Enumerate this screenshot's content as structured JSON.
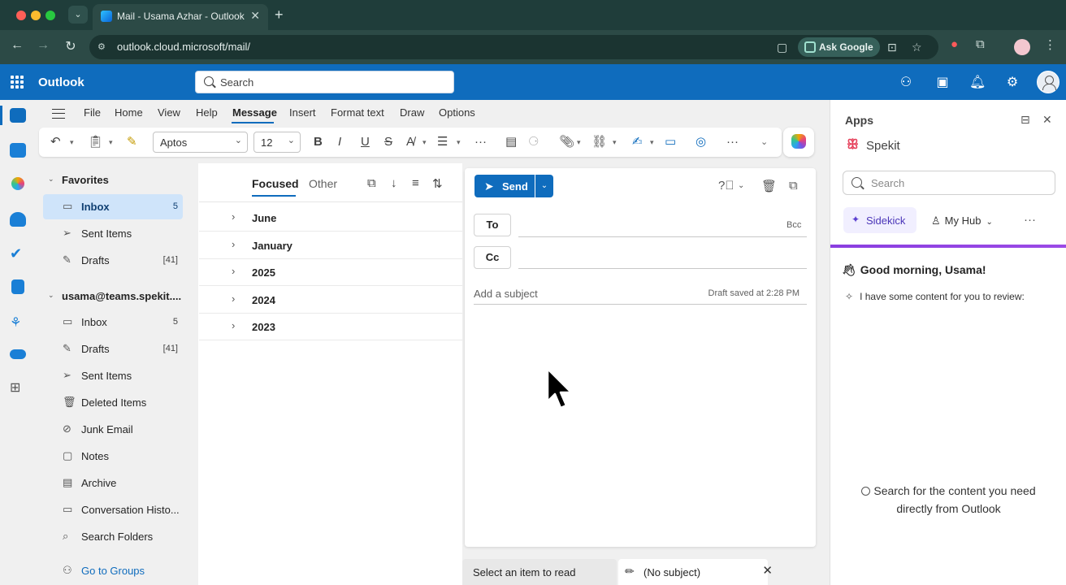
{
  "browser": {
    "tab_title": "Mail - Usama Azhar - Outlook",
    "url": "outlook.cloud.microsoft/mail/",
    "ask_google": "Ask Google"
  },
  "header": {
    "brand": "Outlook",
    "search_placeholder": "Search"
  },
  "ribbon": {
    "tabs": [
      "File",
      "Home",
      "View",
      "Help",
      "Message",
      "Insert",
      "Format text",
      "Draw",
      "Options"
    ],
    "active_tab": "Message",
    "font_name": "Aptos",
    "font_size": "12"
  },
  "folders": {
    "favorites_label": "Favorites",
    "favorites": [
      {
        "label": "Inbox",
        "count": "5",
        "icon": "inbox-icon",
        "selected": true
      },
      {
        "label": "Sent Items",
        "count": "",
        "icon": "send-icon"
      },
      {
        "label": "Drafts",
        "count": "[41]",
        "icon": "pencil-icon"
      }
    ],
    "account_label": "usama@teams.spekit....",
    "account_items": [
      {
        "label": "Inbox",
        "count": "5",
        "icon": "inbox-icon"
      },
      {
        "label": "Drafts",
        "count": "[41]",
        "icon": "pencil-icon"
      },
      {
        "label": "Sent Items",
        "count": "",
        "icon": "send-icon"
      },
      {
        "label": "Deleted Items",
        "count": "",
        "icon": "trash-icon"
      },
      {
        "label": "Junk Email",
        "count": "",
        "icon": "junk-icon"
      },
      {
        "label": "Notes",
        "count": "",
        "icon": "note-icon"
      },
      {
        "label": "Archive",
        "count": "",
        "icon": "archive-icon"
      },
      {
        "label": "Conversation Histo...",
        "count": "",
        "icon": "folder-icon"
      },
      {
        "label": "Search Folders",
        "count": "",
        "icon": "search-folder-icon"
      }
    ],
    "go_to_groups": "Go to Groups"
  },
  "message_list": {
    "focused_label": "Focused",
    "other_label": "Other",
    "groups": [
      "June",
      "January",
      "2025",
      "2024",
      "2023"
    ]
  },
  "compose": {
    "send_label": "Send",
    "to_label": "To",
    "cc_label": "Cc",
    "bcc_label": "Bcc",
    "subject_placeholder": "Add a subject",
    "draft_status": "Draft saved at 2:28 PM"
  },
  "bottom_tabs": {
    "read_label": "Select an item to read",
    "draft_label": "(No subject)"
  },
  "apps_pane": {
    "title": "Apps",
    "app_name": "Spekit",
    "search_placeholder": "Search",
    "tab_sidekick": "Sidekick",
    "tab_hub": "My Hub",
    "greeting": "Good morning, Usama!",
    "review_text": "I have some content for you to review:",
    "search_hint_line1": "Search for the content you need",
    "search_hint_line2": "directly from Outlook"
  },
  "colors": {
    "brand_blue": "#0f6cbd",
    "chrome_green": "#1f3d3a",
    "selection": "#cfe4fa",
    "spekit_purple": "#8a3ee0"
  }
}
